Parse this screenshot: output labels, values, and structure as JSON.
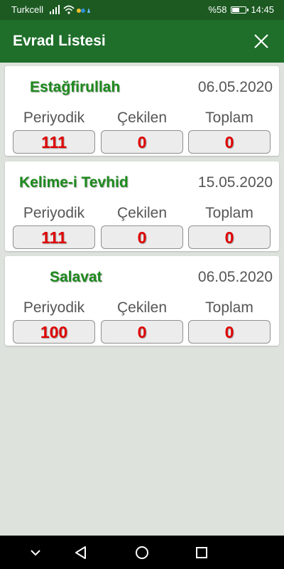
{
  "status_bar": {
    "carrier": "Turkcell",
    "battery": "%58",
    "battery_level": 0.58,
    "time": "14:45"
  },
  "app_bar": {
    "title": "Evrad Listesi",
    "close_icon": "close-icon"
  },
  "column_labels": {
    "periodic": "Periyodik",
    "drawn": "Çekilen",
    "total": "Toplam"
  },
  "cards": [
    {
      "name": "Estağfirullah",
      "date": "06.05.2020",
      "periodic": "111",
      "drawn": "0",
      "total": "0"
    },
    {
      "name": "Kelime-i Tevhid",
      "date": "15.05.2020",
      "periodic": "111",
      "drawn": "0",
      "total": "0"
    },
    {
      "name": "Salavat",
      "date": "06.05.2020",
      "periodic": "100",
      "drawn": "0",
      "total": "0"
    }
  ],
  "colors": {
    "status_bar": "#1c5a22",
    "app_bar": "#1f6e2a",
    "name_green": "#1d8a1d",
    "value_red": "#e00000",
    "background": "#dde2dd"
  },
  "nav_bar": {
    "icons": [
      "chevron-down-icon",
      "back-icon",
      "home-icon",
      "recents-icon"
    ]
  }
}
